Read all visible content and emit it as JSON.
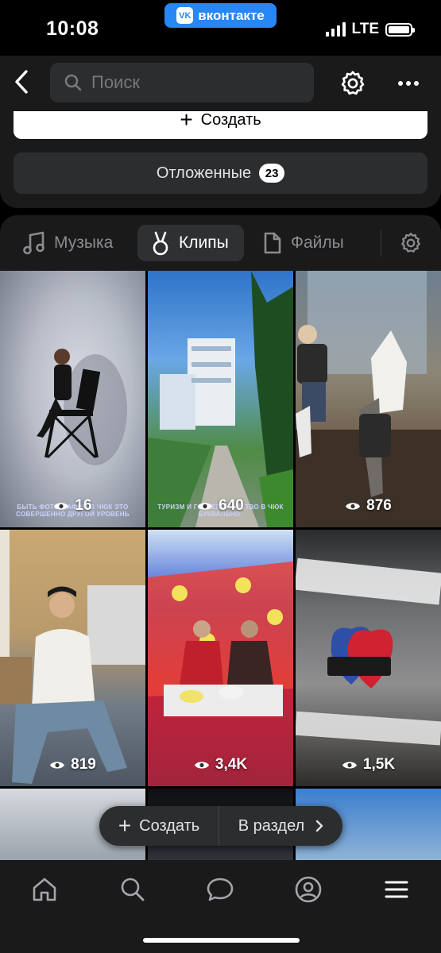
{
  "status_bar": {
    "time": "10:08",
    "app_badge": "вконтакте",
    "app_badge_logo": "VK",
    "network": "LTE"
  },
  "header": {
    "search_placeholder": "Поиск"
  },
  "actions": {
    "create_label": "Создать",
    "deferred_label": "Отложенные",
    "deferred_count": "23"
  },
  "tabs": [
    {
      "label": "Музыка",
      "icon": "music-note-icon",
      "active": false
    },
    {
      "label": "Клипы",
      "icon": "clips-icon",
      "active": true
    },
    {
      "label": "Файлы",
      "icon": "file-icon",
      "active": false
    }
  ],
  "clips": [
    {
      "views": "16",
      "caption": "БЫТЬ ФОТОГРАФОМ В ЧЮК ЭТО СОВЕРШЕННО ДРУГОЙ УРОВЕНЬ"
    },
    {
      "views": "640",
      "caption": "ТУРИЗМ И ГОСТЕПРИИМСТВО В ЧЮК БУКВАЛЬНО:"
    },
    {
      "views": "876"
    },
    {
      "views": "819"
    },
    {
      "views": "3,4K"
    },
    {
      "views": "1,5K"
    }
  ],
  "floating_bar": {
    "create_label": "Создать",
    "section_label": "В раздел"
  },
  "bottom_nav": [
    "home-icon",
    "search-icon",
    "messages-icon",
    "profile-icon",
    "menu-icon"
  ],
  "colors": {
    "accent_vk": "#2787f5",
    "panel": "#1a1a1b",
    "control": "#2c2d2e"
  }
}
